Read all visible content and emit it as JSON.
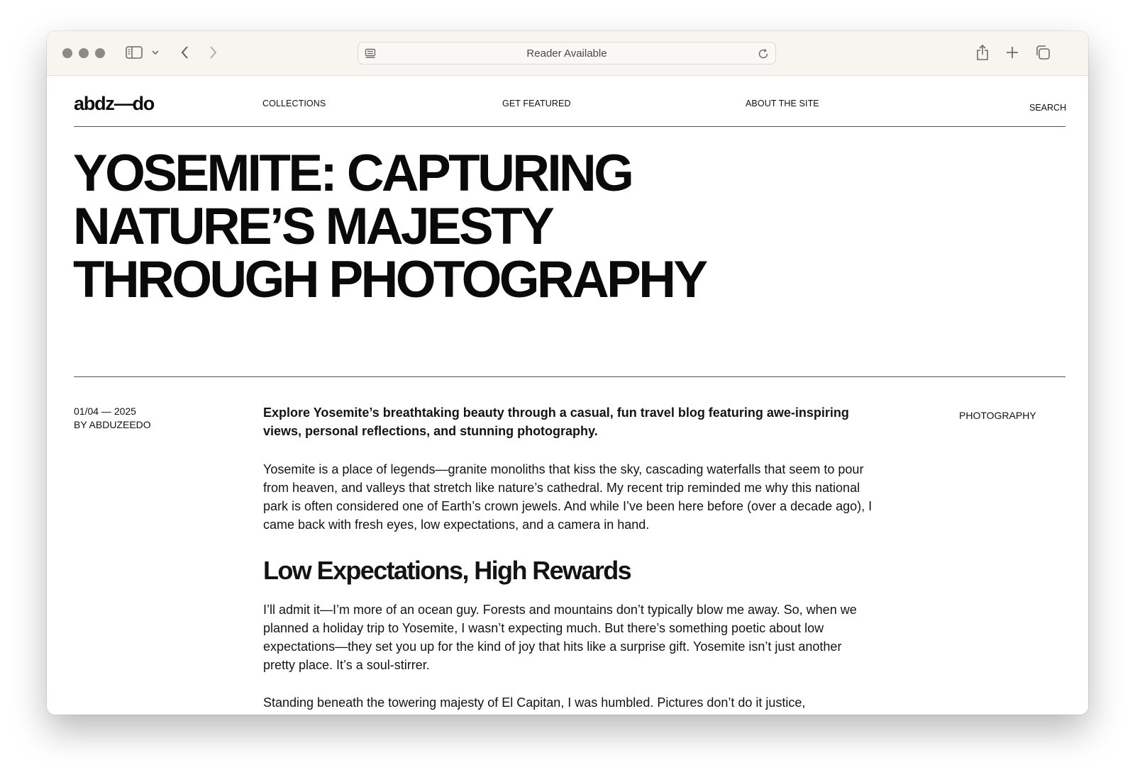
{
  "browser": {
    "address_bar_text": "Reader Available"
  },
  "site": {
    "logo": "abdz—do",
    "nav": [
      "COLLECTIONS",
      "GET FEATURED",
      "ABOUT THE SITE"
    ],
    "search_label": "SEARCH"
  },
  "article": {
    "title": "YOSEMITE: CAPTURING NATURE’S MAJESTY THROUGH PHOTOGRAPHY",
    "date": "01/04 — 2025",
    "byline": "BY ABDUZEEDO",
    "category": "PHOTOGRAPHY",
    "lede": "Explore Yosemite’s breathtaking beauty through a casual, fun travel blog featuring awe-inspiring views, personal reflections, and stunning photography.",
    "paragraph_1": "Yosemite is a place of legends—granite monoliths that kiss the sky, cascading waterfalls that seem to pour from heaven, and valleys that stretch like nature’s cathedral. My recent trip reminded me why this national park is often considered one of Earth’s crown jewels. And while I’ve been here before (over a decade ago), I came back with fresh eyes, low expectations, and a camera in hand.",
    "subheading": "Low Expectations, High Rewards",
    "paragraph_2": "I’ll admit it—I’m more of an ocean guy. Forests and mountains don’t typically blow me away. So, when we planned a holiday trip to Yosemite, I wasn’t expecting much. But there’s something poetic about low expectations—they set you up for the kind of joy that hits like a surprise gift. Yosemite isn’t just another pretty place. It’s a soul-stirrer.",
    "paragraph_3": "Standing beneath the towering majesty of El Capitan, I was humbled. Pictures don’t do it justice,"
  },
  "icons": {
    "sidebar": "sidebar-icon",
    "chevron_down": "chevron-down-icon",
    "back": "back-arrow-icon",
    "forward": "forward-arrow-icon",
    "reader": "reader-icon",
    "reload": "reload-icon",
    "share": "share-icon",
    "new_tab": "plus-icon",
    "tabs": "tab-overview-icon"
  }
}
